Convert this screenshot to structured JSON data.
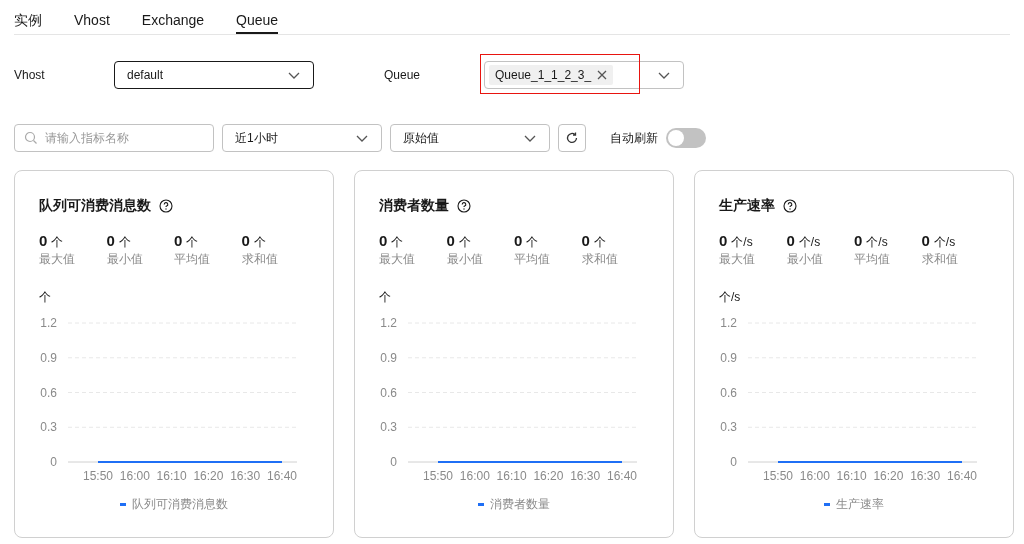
{
  "tabs": [
    {
      "label": "实例",
      "selected": false
    },
    {
      "label": "Vhost",
      "selected": false
    },
    {
      "label": "Exchange",
      "selected": false
    },
    {
      "label": "Queue",
      "selected": true
    }
  ],
  "filters": {
    "vhost": {
      "label": "Vhost",
      "value": "default"
    },
    "queue": {
      "label": "Queue",
      "tags": [
        "Queue_1_1_2_3_"
      ],
      "highlighted": true
    }
  },
  "toolbar": {
    "search": {
      "placeholder": "请输入指标名称"
    },
    "period": "近1小时",
    "mode": "原始值",
    "auto_refresh": {
      "label": "自动刷新",
      "on": false
    }
  },
  "cards": [
    {
      "title": "队列可消费消息数",
      "stats": [
        {
          "value": "0",
          "unit": "个",
          "label": "最大值"
        },
        {
          "value": "0",
          "unit": "个",
          "label": "最小值"
        },
        {
          "value": "0",
          "unit": "个",
          "label": "平均值"
        },
        {
          "value": "0",
          "unit": "个",
          "label": "求和值"
        }
      ],
      "unit": "个",
      "chart_data": {
        "type": "line",
        "categories": [
          "15:50",
          "16:00",
          "16:10",
          "16:20",
          "16:30",
          "16:40"
        ],
        "series": [
          {
            "name": "队列可消费消息数",
            "color": "#1f6ff5",
            "values": [
              0,
              0,
              0,
              0,
              0,
              0
            ]
          }
        ],
        "ylim": [
          0,
          1.2
        ],
        "yticks": [
          0,
          0.3,
          0.6,
          0.9,
          1.2
        ],
        "grid": true
      }
    },
    {
      "title": "消费者数量",
      "stats": [
        {
          "value": "0",
          "unit": "个",
          "label": "最大值"
        },
        {
          "value": "0",
          "unit": "个",
          "label": "最小值"
        },
        {
          "value": "0",
          "unit": "个",
          "label": "平均值"
        },
        {
          "value": "0",
          "unit": "个",
          "label": "求和值"
        }
      ],
      "unit": "个",
      "chart_data": {
        "type": "line",
        "categories": [
          "15:50",
          "16:00",
          "16:10",
          "16:20",
          "16:30",
          "16:40"
        ],
        "series": [
          {
            "name": "消费者数量",
            "color": "#1f6ff5",
            "values": [
              0,
              0,
              0,
              0,
              0,
              0
            ]
          }
        ],
        "ylim": [
          0,
          1.2
        ],
        "yticks": [
          0,
          0.3,
          0.6,
          0.9,
          1.2
        ],
        "grid": true
      }
    },
    {
      "title": "生产速率",
      "stats": [
        {
          "value": "0",
          "unit": "个/s",
          "label": "最大值"
        },
        {
          "value": "0",
          "unit": "个/s",
          "label": "最小值"
        },
        {
          "value": "0",
          "unit": "个/s",
          "label": "平均值"
        },
        {
          "value": "0",
          "unit": "个/s",
          "label": "求和值"
        }
      ],
      "unit": "个/s",
      "chart_data": {
        "type": "line",
        "categories": [
          "15:50",
          "16:00",
          "16:10",
          "16:20",
          "16:30",
          "16:40"
        ],
        "series": [
          {
            "name": "生产速率",
            "color": "#1f6ff5",
            "values": [
              0,
              0,
              0,
              0,
              0,
              0
            ]
          }
        ],
        "ylim": [
          0,
          1.2
        ],
        "yticks": [
          0,
          0.3,
          0.6,
          0.9,
          1.2
        ],
        "grid": true
      }
    }
  ]
}
